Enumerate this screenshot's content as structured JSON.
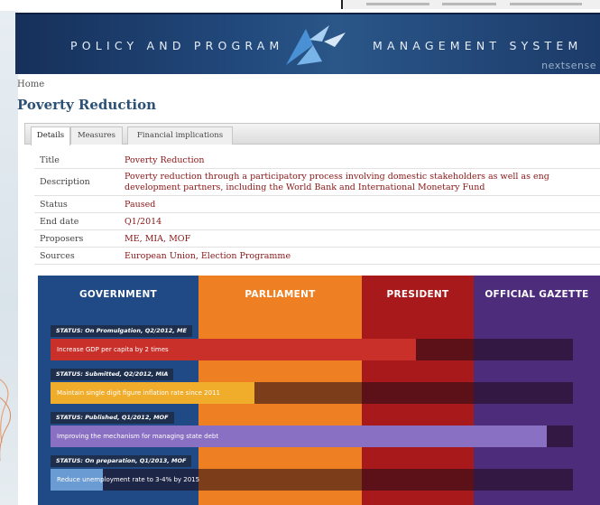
{
  "header": {
    "title_left": "POLICY AND PROGRAM",
    "title_right": "MANAGEMENT SYSTEM",
    "brand": "nextsense"
  },
  "breadcrumb": "Home",
  "page_title": "Poverty Reduction",
  "tabs": [
    {
      "label": "Details",
      "active": true
    },
    {
      "label": "Measures",
      "active": false
    },
    {
      "label": "Financial implications",
      "active": false
    }
  ],
  "details": [
    {
      "label": "Title",
      "value": "Poverty Reduction"
    },
    {
      "label": "Description",
      "value": "Poverty reduction through a participatory process involving domestic stakeholders as well as eng development partners, including the World Bank and International Monetary Fund"
    },
    {
      "label": "Status",
      "value": "Paused"
    },
    {
      "label": "End date",
      "value": "Q1/2014"
    },
    {
      "label": "Proposers",
      "value": "ME, MIA, MOF"
    },
    {
      "label": "Sources",
      "value": "European Union, Election Programme"
    }
  ],
  "columns": [
    {
      "label": "GOVERNMENT",
      "color": "#1f4a86"
    },
    {
      "label": "PARLIAMENT",
      "color": "#ef7f23"
    },
    {
      "label": "PRESIDENT",
      "color": "#a8191c"
    },
    {
      "label": "OFFICIAL GAZETTE",
      "color": "#4e2c7c"
    }
  ],
  "measures": [
    {
      "status": "STATUS: On Promulgation, Q2/2012, ME",
      "label": "Increase GDP per capita by 2 times",
      "progress": 0.7,
      "color": "#c9302a"
    },
    {
      "status": "STATUS: Submitted, Q2/2012, MIA",
      "label": "Maintain single digit figure inflation rate since 2011",
      "progress": 0.39,
      "color": "#f0ad2c"
    },
    {
      "status": "STATUS: Published, Q1/2012, MOF",
      "label": "Improving the mechanism for managing state debt",
      "progress": 0.95,
      "color": "#8a70c2"
    },
    {
      "status": "STATUS: On preparation, Q1/2013, MOF",
      "label": "Reduce unemployment rate to 3-4% by 2015",
      "progress": 0.1,
      "color": "#6a9bd3"
    }
  ]
}
